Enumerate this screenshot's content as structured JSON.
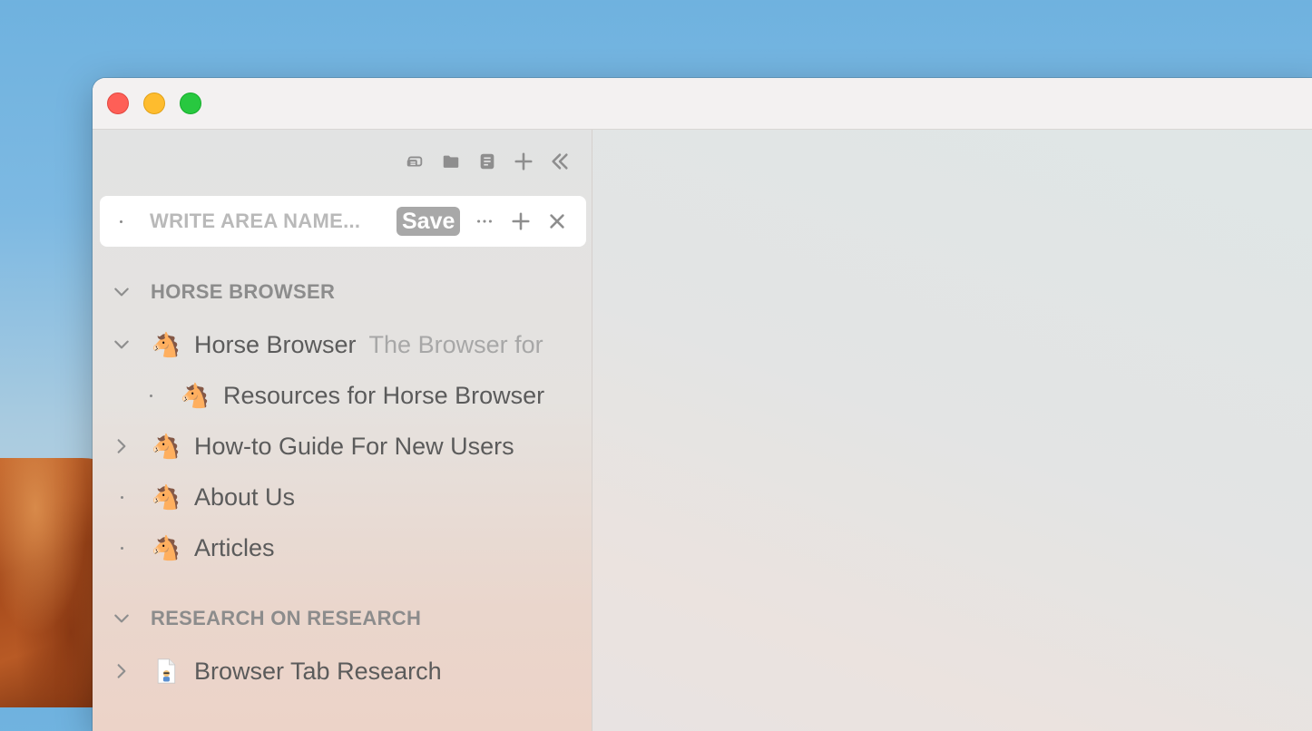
{
  "window": {
    "traffic_lights": [
      "close",
      "minimize",
      "maximize"
    ]
  },
  "toolbar": {
    "icons": [
      "tabs-icon",
      "folder-icon",
      "note-icon",
      "plus-icon",
      "collapse-sidebar-icon"
    ]
  },
  "area_input": {
    "placeholder": "WRITE AREA NAME...",
    "value": "",
    "save_label": "Save"
  },
  "sections": [
    {
      "title": "HORSE BROWSER",
      "items": [
        {
          "label": "Horse Browser",
          "description": "The Browser for",
          "emoji": "🐴",
          "state": "expanded"
        },
        {
          "label": "Resources for Horse Browser",
          "emoji": "🐴",
          "state": "leaf",
          "indent": 1
        },
        {
          "label": "How-to Guide For New Users",
          "emoji": "🐴",
          "state": "collapsed"
        },
        {
          "label": "About Us",
          "emoji": "🐴",
          "state": "leaf"
        },
        {
          "label": "Articles",
          "emoji": "🐴",
          "state": "leaf"
        }
      ]
    },
    {
      "title": "RESEARCH ON RESEARCH",
      "items": [
        {
          "label": "Browser Tab Research",
          "icon": "document-icon",
          "state": "collapsed"
        }
      ]
    }
  ],
  "colors": {
    "close": "#fe5f57",
    "minimize": "#febc2e",
    "maximize": "#28c840",
    "icon_gray": "#8e8e8e",
    "text": "#5b5b5b",
    "muted_text": "#a7a7a7"
  }
}
